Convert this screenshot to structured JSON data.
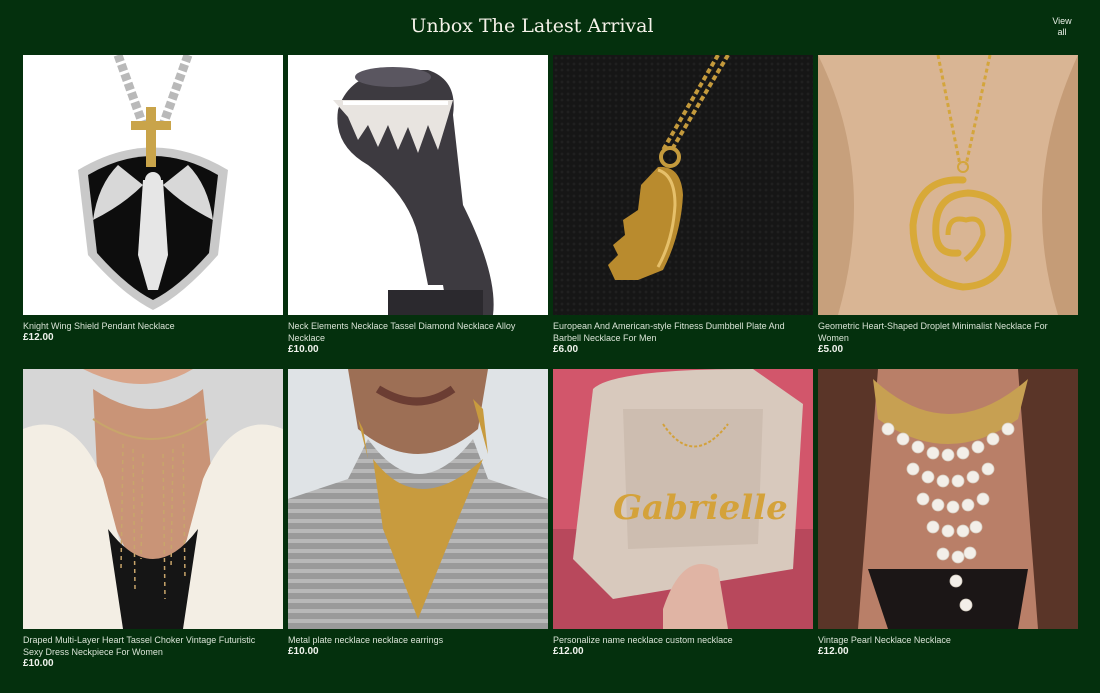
{
  "section": {
    "title": "Unbox The Latest Arrival",
    "view_all_line1": "View",
    "view_all_line2": "all"
  },
  "products": [
    {
      "name": "Knight Wing Shield Pendant Necklace",
      "price": "£12.00",
      "image_icon": "shield-pendant-necklace-image"
    },
    {
      "name": "Neck Elements Necklace Tassel Diamond Necklace Alloy Necklace",
      "price": "£10.00",
      "image_icon": "diamond-tassel-necklace-image"
    },
    {
      "name": "European And American-style Fitness Dumbbell Plate And Barbell Necklace For Men",
      "price": "£6.00",
      "image_icon": "dumbbell-plate-necklace-image"
    },
    {
      "name": "Geometric Heart-Shaped Droplet Minimalist Necklace For Women",
      "price": "£5.00",
      "image_icon": "heart-droplet-necklace-image"
    },
    {
      "name": "Draped Multi-Layer Heart Tassel Choker Vintage Futuristic Sexy Dress Neckpiece For Women",
      "price": "£10.00",
      "image_icon": "tassel-choker-image"
    },
    {
      "name": "Metal plate necklace necklace earrings",
      "price": "£10.00",
      "image_icon": "metal-plate-necklace-image"
    },
    {
      "name": "Personalize name necklace custom necklace",
      "price": "£12.00",
      "image_icon": "name-necklace-image"
    },
    {
      "name": "Vintage Pearl Necklace Necklace",
      "price": "£12.00",
      "image_icon": "pearl-necklace-image"
    }
  ],
  "colors": {
    "background": "#04300d",
    "text": "#e8efe6"
  }
}
